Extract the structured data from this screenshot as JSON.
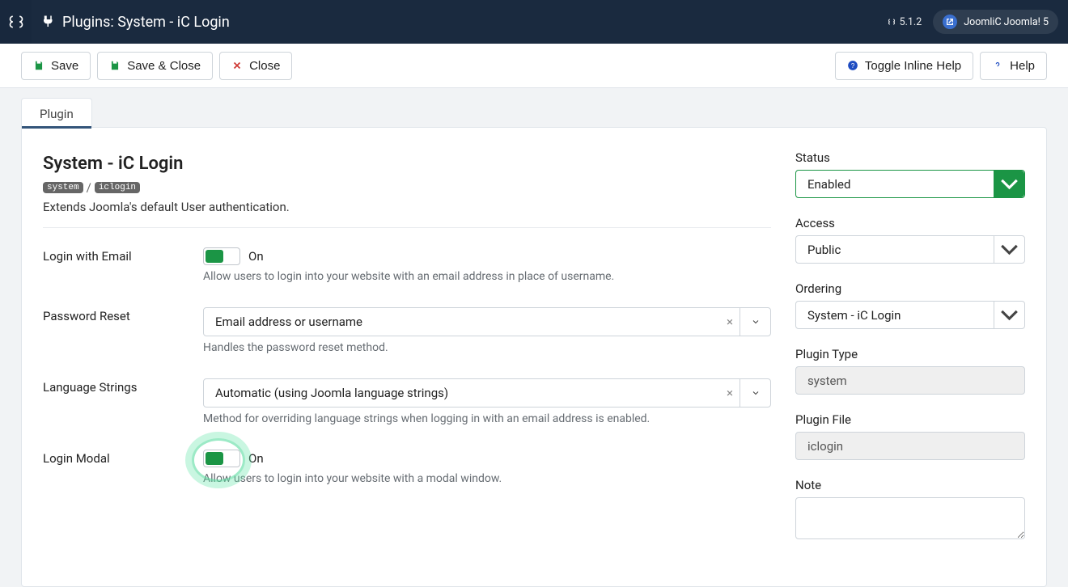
{
  "header": {
    "title": "Plugins: System - iC Login",
    "version": "5.1.2",
    "site": "JoomliC Joomla! 5"
  },
  "toolbar": {
    "save": "Save",
    "save_close": "Save & Close",
    "close": "Close",
    "toggle_help": "Toggle Inline Help",
    "help": "Help"
  },
  "tab": {
    "plugin": "Plugin"
  },
  "plugin": {
    "title": "System - iC Login",
    "folder": "system",
    "element": "iclogin",
    "description": "Extends Joomla's default User authentication."
  },
  "fields": {
    "login_email": {
      "label": "Login with Email",
      "state": "On",
      "hint": "Allow users to login into your website with an email address in place of username."
    },
    "password_reset": {
      "label": "Password Reset",
      "value": "Email address or username",
      "hint": "Handles the password reset method."
    },
    "lang_strings": {
      "label": "Language Strings",
      "value": "Automatic (using Joomla language strings)",
      "hint": "Method for overriding language strings when logging in with an email address is enabled."
    },
    "login_modal": {
      "label": "Login Modal",
      "state": "On",
      "hint": "Allow users to login into your website with a modal window."
    }
  },
  "side": {
    "status_label": "Status",
    "status_value": "Enabled",
    "access_label": "Access",
    "access_value": "Public",
    "ordering_label": "Ordering",
    "ordering_value": "System - iC Login",
    "type_label": "Plugin Type",
    "type_value": "system",
    "file_label": "Plugin File",
    "file_value": "iclogin",
    "note_label": "Note"
  }
}
